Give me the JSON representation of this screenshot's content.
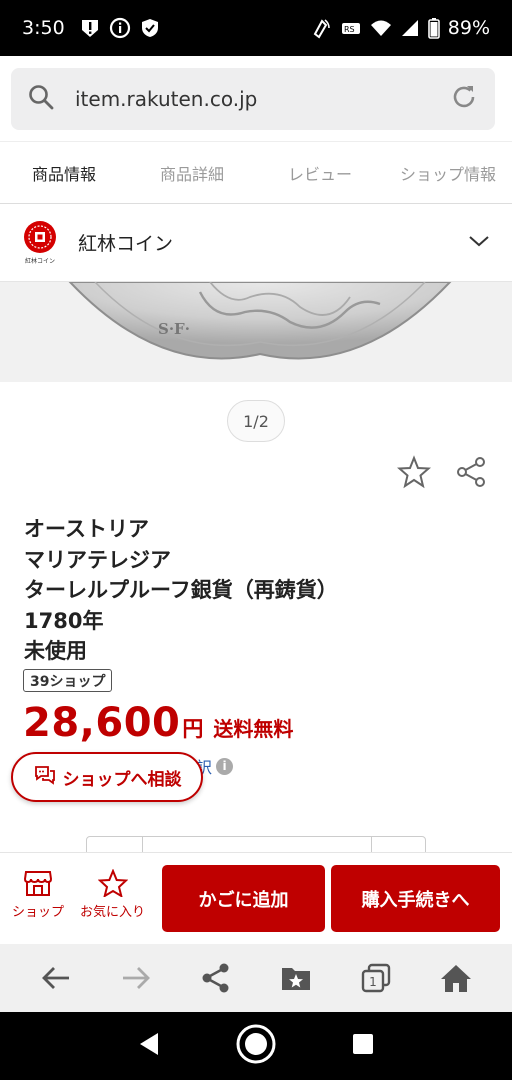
{
  "status_bar": {
    "time": "3:50",
    "battery": "89%"
  },
  "url_bar": {
    "url": "item.rakuten.co.jp"
  },
  "tabs": [
    {
      "label": "商品情報",
      "active": true
    },
    {
      "label": "商品詳細",
      "active": false
    },
    {
      "label": "レビュー",
      "active": false
    },
    {
      "label": "ショップ情報",
      "active": false
    }
  ],
  "shop": {
    "name": "紅林コイン",
    "logo_text": "紅林コイン"
  },
  "gallery": {
    "pager": "1/2",
    "image_inscription": "S·F·"
  },
  "product": {
    "title_lines": [
      "オーストリア",
      "マリアテレジア",
      "ターレルプルーフ銀貨（再鋳貨）",
      "1780年",
      "未使用"
    ],
    "badge": "39ショップ",
    "price": "28,600",
    "currency": "円",
    "shipping": "送料無料",
    "breakdown_partial": "訳"
  },
  "consult_button": {
    "label": "ショップへ相談"
  },
  "action_bar": {
    "shop_label": "ショップ",
    "favorite_label": "お気に入り",
    "cart_label": "かごに追加",
    "buy_label": "購入手続きへ"
  },
  "browser_toolbar": {
    "tab_count": "1"
  },
  "colors": {
    "brand_red": "#bf0000",
    "link_blue": "#2a5db0"
  }
}
